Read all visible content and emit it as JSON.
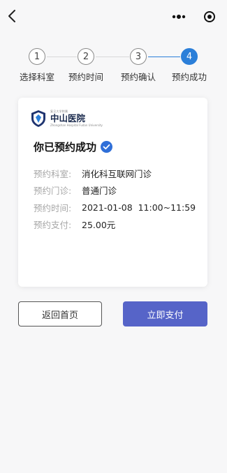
{
  "header": {
    "back_icon": "chevron-left-icon",
    "more_icon": "more-dots-icon",
    "close_icon": "close-circle-icon"
  },
  "stepper": {
    "steps": [
      {
        "number": "1",
        "label": "选择科室"
      },
      {
        "number": "2",
        "label": "预约时间"
      },
      {
        "number": "3",
        "label": "预约确认"
      },
      {
        "number": "4",
        "label": "预约成功"
      }
    ],
    "current": 4,
    "accent_color": "#2b7fd9"
  },
  "card": {
    "hospital": {
      "small_top": "复旦大学附属",
      "name": "中山医院",
      "small_bottom": "Zhongshan Hospital Fudan University"
    },
    "success_title": "你已预约成功",
    "details": [
      {
        "label": "预约科室:",
        "value": "消化科互联网门诊"
      },
      {
        "label": "预约门诊:",
        "value": "普通门诊"
      },
      {
        "label": "预约时间:",
        "value": "2021-01-08  11:00~11:59"
      },
      {
        "label": "预约支付:",
        "value": "25.00元"
      }
    ]
  },
  "buttons": {
    "home_label": "返回首页",
    "pay_label": "立即支付",
    "pay_color": "#5664c8"
  }
}
